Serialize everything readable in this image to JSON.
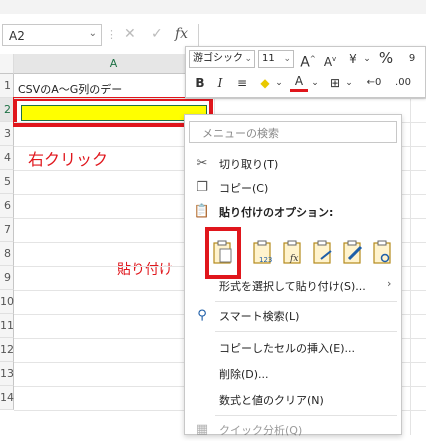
{
  "ribbon": {
    "fragment": "　　　　　　　　　　　　　　　　"
  },
  "namebox": {
    "value": "A2"
  },
  "formula_bar": {
    "fx": "fx"
  },
  "columns": {
    "a": "A"
  },
  "rows": [
    "1",
    "2",
    "3",
    "4",
    "5",
    "6",
    "7",
    "8",
    "9",
    "10",
    "11",
    "12",
    "13",
    "14"
  ],
  "cell_a1": "CSVのA～G列のデー",
  "annotations": {
    "right_click": "右クリック",
    "paste": "貼り付け"
  },
  "mini_toolbar": {
    "font_name": "游ゴシック",
    "font_size": "11",
    "grow_font": "A",
    "shrink_font": "A",
    "currency": "¥",
    "percent": "%",
    "bold": "B",
    "italic": "I",
    "font_color_letter": "A"
  },
  "context_menu": {
    "search_placeholder": "メニューの検索",
    "cut": "切り取り(T)",
    "copy": "コピー(C)",
    "paste_options": "貼り付けのオプション:",
    "paste_special": "形式を選択して貼り付け(S)...",
    "smart_lookup": "スマート検索(L)",
    "insert_copied": "コピーしたセルの挿入(E)...",
    "delete": "削除(D)...",
    "clear": "数式と値のクリア(N)",
    "quick_analysis": "クイック分析(Q)"
  },
  "colors": {
    "annotation_red": "#e0161c",
    "selection_fill": "#ffff00",
    "excel_green": "#1e7145"
  }
}
